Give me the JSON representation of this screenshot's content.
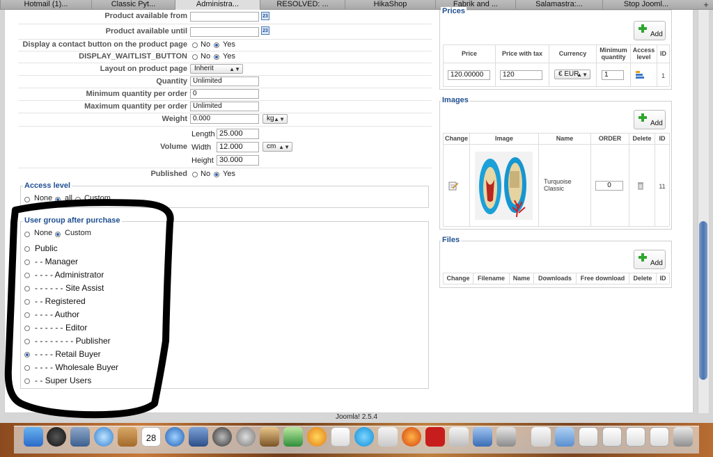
{
  "tabs": [
    "Hotmail (1)...",
    "Classic Pyt...",
    "Administra...",
    "RESOLVED: ...",
    "HikaShop",
    "Fabrik and ...",
    "Salamastra:...",
    "Stop Jooml..."
  ],
  "active_tab_index": 2,
  "new_tab": "+",
  "form": {
    "available_from_label": "Product available from",
    "available_until_label": "Product available until",
    "contact_label": "Display a contact button on the product page",
    "waitlist_label": "DISPLAY_WAITLIST_BUTTON",
    "layout_label": "Layout on product page",
    "layout_value": "Inherit",
    "quantity_label": "Quantity",
    "quantity_value": "Unlimited",
    "min_qty_label": "Minimum quantity per order",
    "min_qty_value": "0",
    "max_qty_label": "Maximum quantity per order",
    "max_qty_value": "Unlimited",
    "weight_label": "Weight",
    "weight_value": "0.000",
    "weight_unit": "kg",
    "volume_label": "Volume",
    "length_label": "Length",
    "length_value": "25.000",
    "width_label": "Width",
    "width_value": "12.000",
    "volume_unit": "cm",
    "height_label": "Height",
    "height_value": "30.000",
    "published_label": "Published",
    "no": "No",
    "yes": "Yes",
    "cal_icon_text": "23"
  },
  "access_level": {
    "legend": "Access level",
    "none": "None",
    "all": "all",
    "custom": "Custom"
  },
  "user_group": {
    "legend": "User group after purchase",
    "none": "None",
    "custom": "Custom",
    "groups": [
      "Public",
      "- - Manager",
      "- - - - Administrator",
      "- - - - - - Site Assist",
      "- - Registered",
      "- - - - Author",
      "- - - - - - Editor",
      "- - - - - - - - Publisher",
      "- - - - Retail Buyer",
      "- - - - Wholesale Buyer",
      "- - Super Users"
    ],
    "selected_index": 8
  },
  "prices": {
    "legend": "Prices",
    "add": "Add",
    "headers": [
      "Price",
      "Price with tax",
      "Currency",
      "Minimum quantity",
      "Access level",
      "ID"
    ],
    "row": {
      "price": "120.00000",
      "price_tax": "120",
      "currency": "€ EUR",
      "min_qty": "1",
      "id": "1"
    }
  },
  "images": {
    "legend": "Images",
    "add": "Add",
    "headers": [
      "Change",
      "Image",
      "Name",
      "ORDER",
      "Delete",
      "ID"
    ],
    "row": {
      "name": "Turquoise Classic",
      "order": "0",
      "id": "11"
    }
  },
  "files": {
    "legend": "Files",
    "add": "Add",
    "headers": [
      "Change",
      "Filename",
      "Name",
      "Downloads",
      "Free download",
      "Delete",
      "ID"
    ]
  },
  "footer": "Joomla! 2.5.4",
  "dock": {
    "calendar_day": "28"
  },
  "colors": {
    "legend_blue": "#1f4f91",
    "radio_selected": "#2c62b0",
    "add_green": "#2fa72f",
    "annotation": "#000000"
  }
}
